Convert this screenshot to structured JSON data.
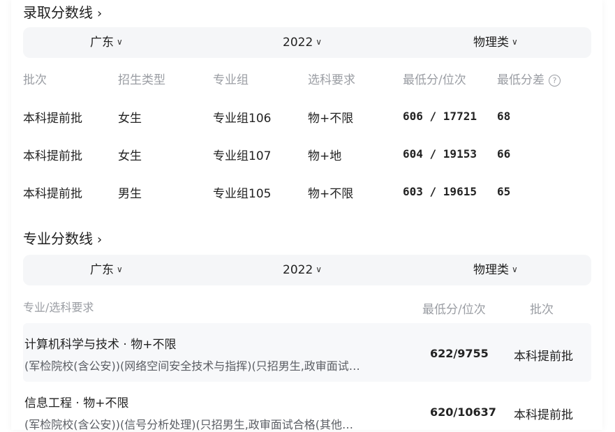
{
  "admission_section": {
    "title": "录取分数线",
    "filters": {
      "province": "广东",
      "year": "2022",
      "subject_type": "物理类"
    },
    "headers": [
      "批次",
      "招生类型",
      "专业组",
      "选科要求",
      "最低分/位次",
      "最低分差"
    ],
    "rows": [
      {
        "batch": "本科提前批",
        "type": "女生",
        "group": "专业组106",
        "subjects": "物+不限",
        "score_rank": "606 / 17721",
        "diff": "68"
      },
      {
        "batch": "本科提前批",
        "type": "女生",
        "group": "专业组107",
        "subjects": "物+地",
        "score_rank": "604 / 19153",
        "diff": "66"
      },
      {
        "batch": "本科提前批",
        "type": "男生",
        "group": "专业组105",
        "subjects": "物+不限",
        "score_rank": "603 / 19615",
        "diff": "65"
      }
    ]
  },
  "major_section": {
    "title": "专业分数线",
    "filters": {
      "province": "广东",
      "year": "2022",
      "subject_type": "物理类"
    },
    "headers": {
      "major": "专业/选科要求",
      "score_rank": "最低分/位次",
      "batch": "批次"
    },
    "rows": [
      {
        "name": "计算机科学与技术 · 物+不限",
        "detail": "(军检院校(含公安))(网络空间安全技术与指挥)(只招男生,政审面试…",
        "score_rank": "622/9755",
        "batch": "本科提前批"
      },
      {
        "name": "信息工程 · 物+不限",
        "detail": "(军检院校(含公安))(信号分析处理)(只招男生,政审面试合格(其他…",
        "score_rank": "620/10637",
        "batch": "本科提前批"
      }
    ]
  },
  "icons": {
    "chevron": "chevron-right-icon",
    "caret": "chevron-down-icon",
    "help": "question-circle-icon"
  }
}
